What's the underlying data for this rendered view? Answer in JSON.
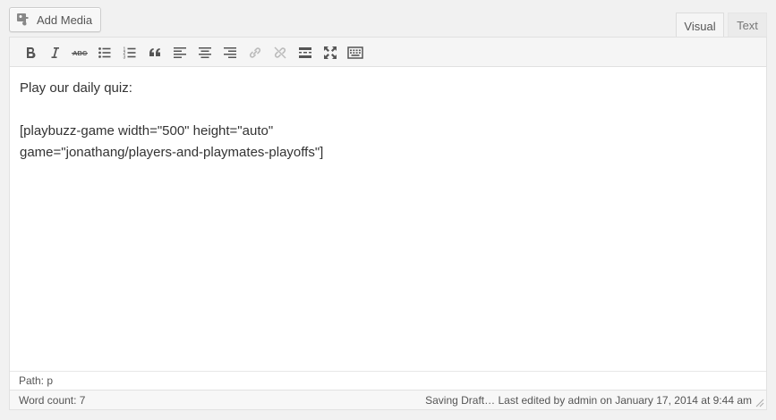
{
  "header": {
    "add_media_label": "Add Media",
    "tabs": [
      {
        "label": "Visual",
        "active": true
      },
      {
        "label": "Text",
        "active": false
      }
    ]
  },
  "toolbar": {
    "buttons": [
      {
        "icon": "bold-icon",
        "enabled": true
      },
      {
        "icon": "italic-icon",
        "enabled": true
      },
      {
        "icon": "strikethrough-icon",
        "enabled": true
      },
      {
        "icon": "bulleted-list-icon",
        "enabled": true
      },
      {
        "icon": "numbered-list-icon",
        "enabled": true
      },
      {
        "icon": "blockquote-icon",
        "enabled": true
      },
      {
        "icon": "align-left-icon",
        "enabled": true
      },
      {
        "icon": "align-center-icon",
        "enabled": true
      },
      {
        "icon": "align-right-icon",
        "enabled": true
      },
      {
        "icon": "insert-link-icon",
        "enabled": false
      },
      {
        "icon": "remove-link-icon",
        "enabled": false
      },
      {
        "icon": "insert-more-tag-icon",
        "enabled": true
      },
      {
        "icon": "fullscreen-icon",
        "enabled": true
      },
      {
        "icon": "toolbar-toggle-icon",
        "enabled": true
      }
    ]
  },
  "content": {
    "paragraph_1": "Play our daily quiz:",
    "shortcode_line_1": "[playbuzz-game width=\"500\" height=\"auto\"",
    "shortcode_line_2": "game=\"jonathang/players-and-playmates-playoffs\"]"
  },
  "path_bar": {
    "text": "Path: p"
  },
  "status_bar": {
    "word_count": "Word count: 7",
    "last_edited": "Saving Draft… Last edited by admin on January 17, 2014 at 9:44 am"
  },
  "colors": {
    "background": "#f1f1f1",
    "toolbar": "#f5f5f5",
    "border": "#e1e1e1",
    "icon": "#555555"
  }
}
